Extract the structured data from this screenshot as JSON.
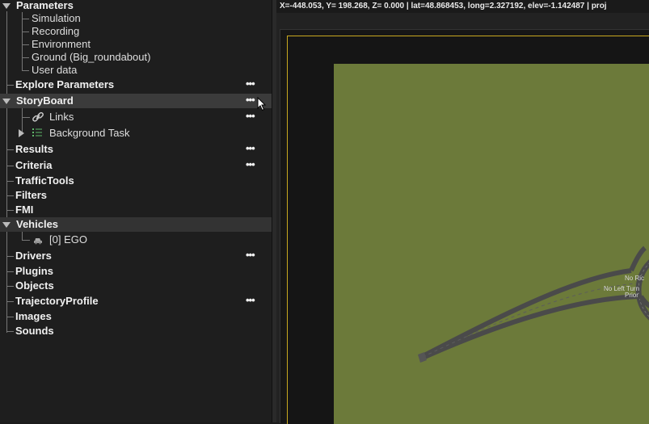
{
  "status": {
    "coordinates": "X=-448.053, Y= 198.268, Z=   0.000 | lat=48.868453, long=2.327192, elev=-1.142487 | proj"
  },
  "tree": {
    "parameters": {
      "label": "Parameters",
      "children": [
        "Simulation",
        "Recording",
        "Environment",
        "Ground (Big_roundabout)",
        "User data"
      ]
    },
    "explore_parameters": {
      "label": "Explore Parameters",
      "more": "•••"
    },
    "storyboard": {
      "label": "StoryBoard",
      "more": "•••",
      "links": {
        "label": "Links",
        "more": "•••"
      },
      "background_task": {
        "label": "Background Task"
      }
    },
    "results": {
      "label": "Results",
      "more": "•••"
    },
    "criteria": {
      "label": "Criteria",
      "more": "•••"
    },
    "traffictools": {
      "label": "TrafficTools"
    },
    "filters": {
      "label": "Filters"
    },
    "fmi": {
      "label": "FMI"
    },
    "vehicles": {
      "label": "Vehicles",
      "ego": {
        "label": "[0] EGO"
      }
    },
    "drivers": {
      "label": "Drivers",
      "more": "•••"
    },
    "plugins": {
      "label": "Plugins"
    },
    "objects": {
      "label": "Objects"
    },
    "trajectory_profile": {
      "label": "TrajectoryProfile",
      "more": "•••"
    },
    "images": {
      "label": "Images"
    },
    "sounds": {
      "label": "Sounds"
    }
  },
  "scene": {
    "sign_labels": [
      "No Ric",
      "No Left Turn",
      "Prior"
    ]
  },
  "colors": {
    "ground": "#6c7a3a",
    "road": "#4a4a4a",
    "scene_border": "#c8a820"
  }
}
